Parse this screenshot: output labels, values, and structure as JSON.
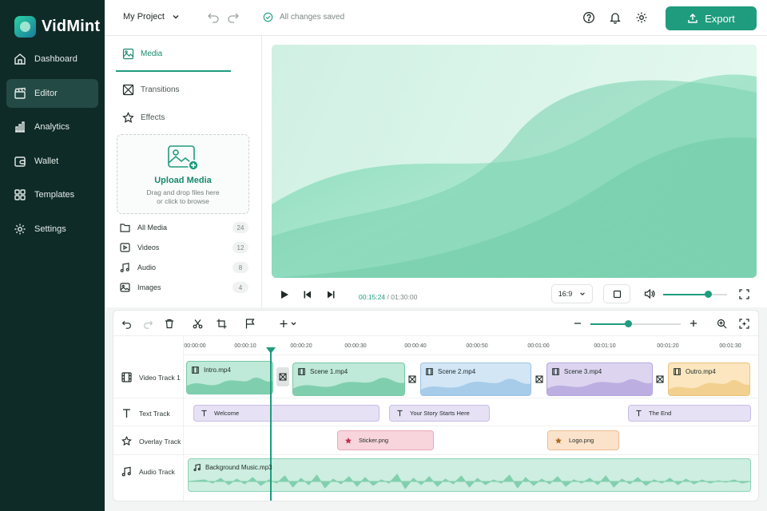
{
  "app": {
    "name": "VidMint"
  },
  "sidebar": {
    "items": [
      {
        "label": "Dashboard",
        "icon": "home-icon"
      },
      {
        "label": "Editor",
        "icon": "clapperboard-icon",
        "active": true
      },
      {
        "label": "Analytics",
        "icon": "bar-chart-icon"
      },
      {
        "label": "Wallet",
        "icon": "wallet-icon"
      },
      {
        "label": "Templates",
        "icon": "grid-icon"
      },
      {
        "label": "Settings",
        "icon": "gear-icon"
      }
    ]
  },
  "topbar": {
    "project": "My Project",
    "save_status": "All changes saved",
    "export_label": "Export"
  },
  "panel": {
    "tabs": [
      {
        "label": "Media"
      },
      {
        "label": "Transitions"
      },
      {
        "label": "Effects"
      }
    ],
    "upload": {
      "title": "Upload Media",
      "line1": "Drag and drop files here",
      "line2": "or click to browse"
    },
    "categories": [
      {
        "label": "All Media",
        "count": "24"
      },
      {
        "label": "Videos",
        "count": "12"
      },
      {
        "label": "Audio",
        "count": "8"
      },
      {
        "label": "Images",
        "count": "4"
      }
    ]
  },
  "player": {
    "current_time": "00:15:24",
    "separator": "/",
    "total_time": "01:30:00",
    "aspect_ratio": "16:9",
    "volume": 0.7
  },
  "timeline": {
    "zoom": 0.42,
    "ruler": [
      "00:00:00",
      "00:00:10",
      "00:00:20",
      "00:00:30",
      "00:00:40",
      "00:00:50",
      "00:01:00",
      "00:01:10",
      "00:01:20",
      "00:01:30"
    ],
    "tracks": [
      {
        "label": "Video Track 1"
      },
      {
        "label": "Text Track"
      },
      {
        "label": "Overlay Track"
      },
      {
        "label": "Audio Track"
      }
    ],
    "video_clips": [
      {
        "label": "Intro.mp4"
      },
      {
        "label": "Scene 1.mp4"
      },
      {
        "label": "Scene 2.mp4"
      },
      {
        "label": "Scene 3.mp4"
      },
      {
        "label": "Outro.mp4"
      }
    ],
    "text_clips": [
      {
        "label": "Welcome"
      },
      {
        "label": "Your Story Starts Here"
      },
      {
        "label": "The End"
      }
    ],
    "overlay_clips": [
      {
        "label": "Sticker.png"
      },
      {
        "label": "Logo.png"
      }
    ],
    "audio_clips": [
      {
        "label": "Background Music.mp3"
      }
    ]
  },
  "colors": {
    "accent": "#1f9c7e",
    "sidebar": "#0f2b28"
  }
}
